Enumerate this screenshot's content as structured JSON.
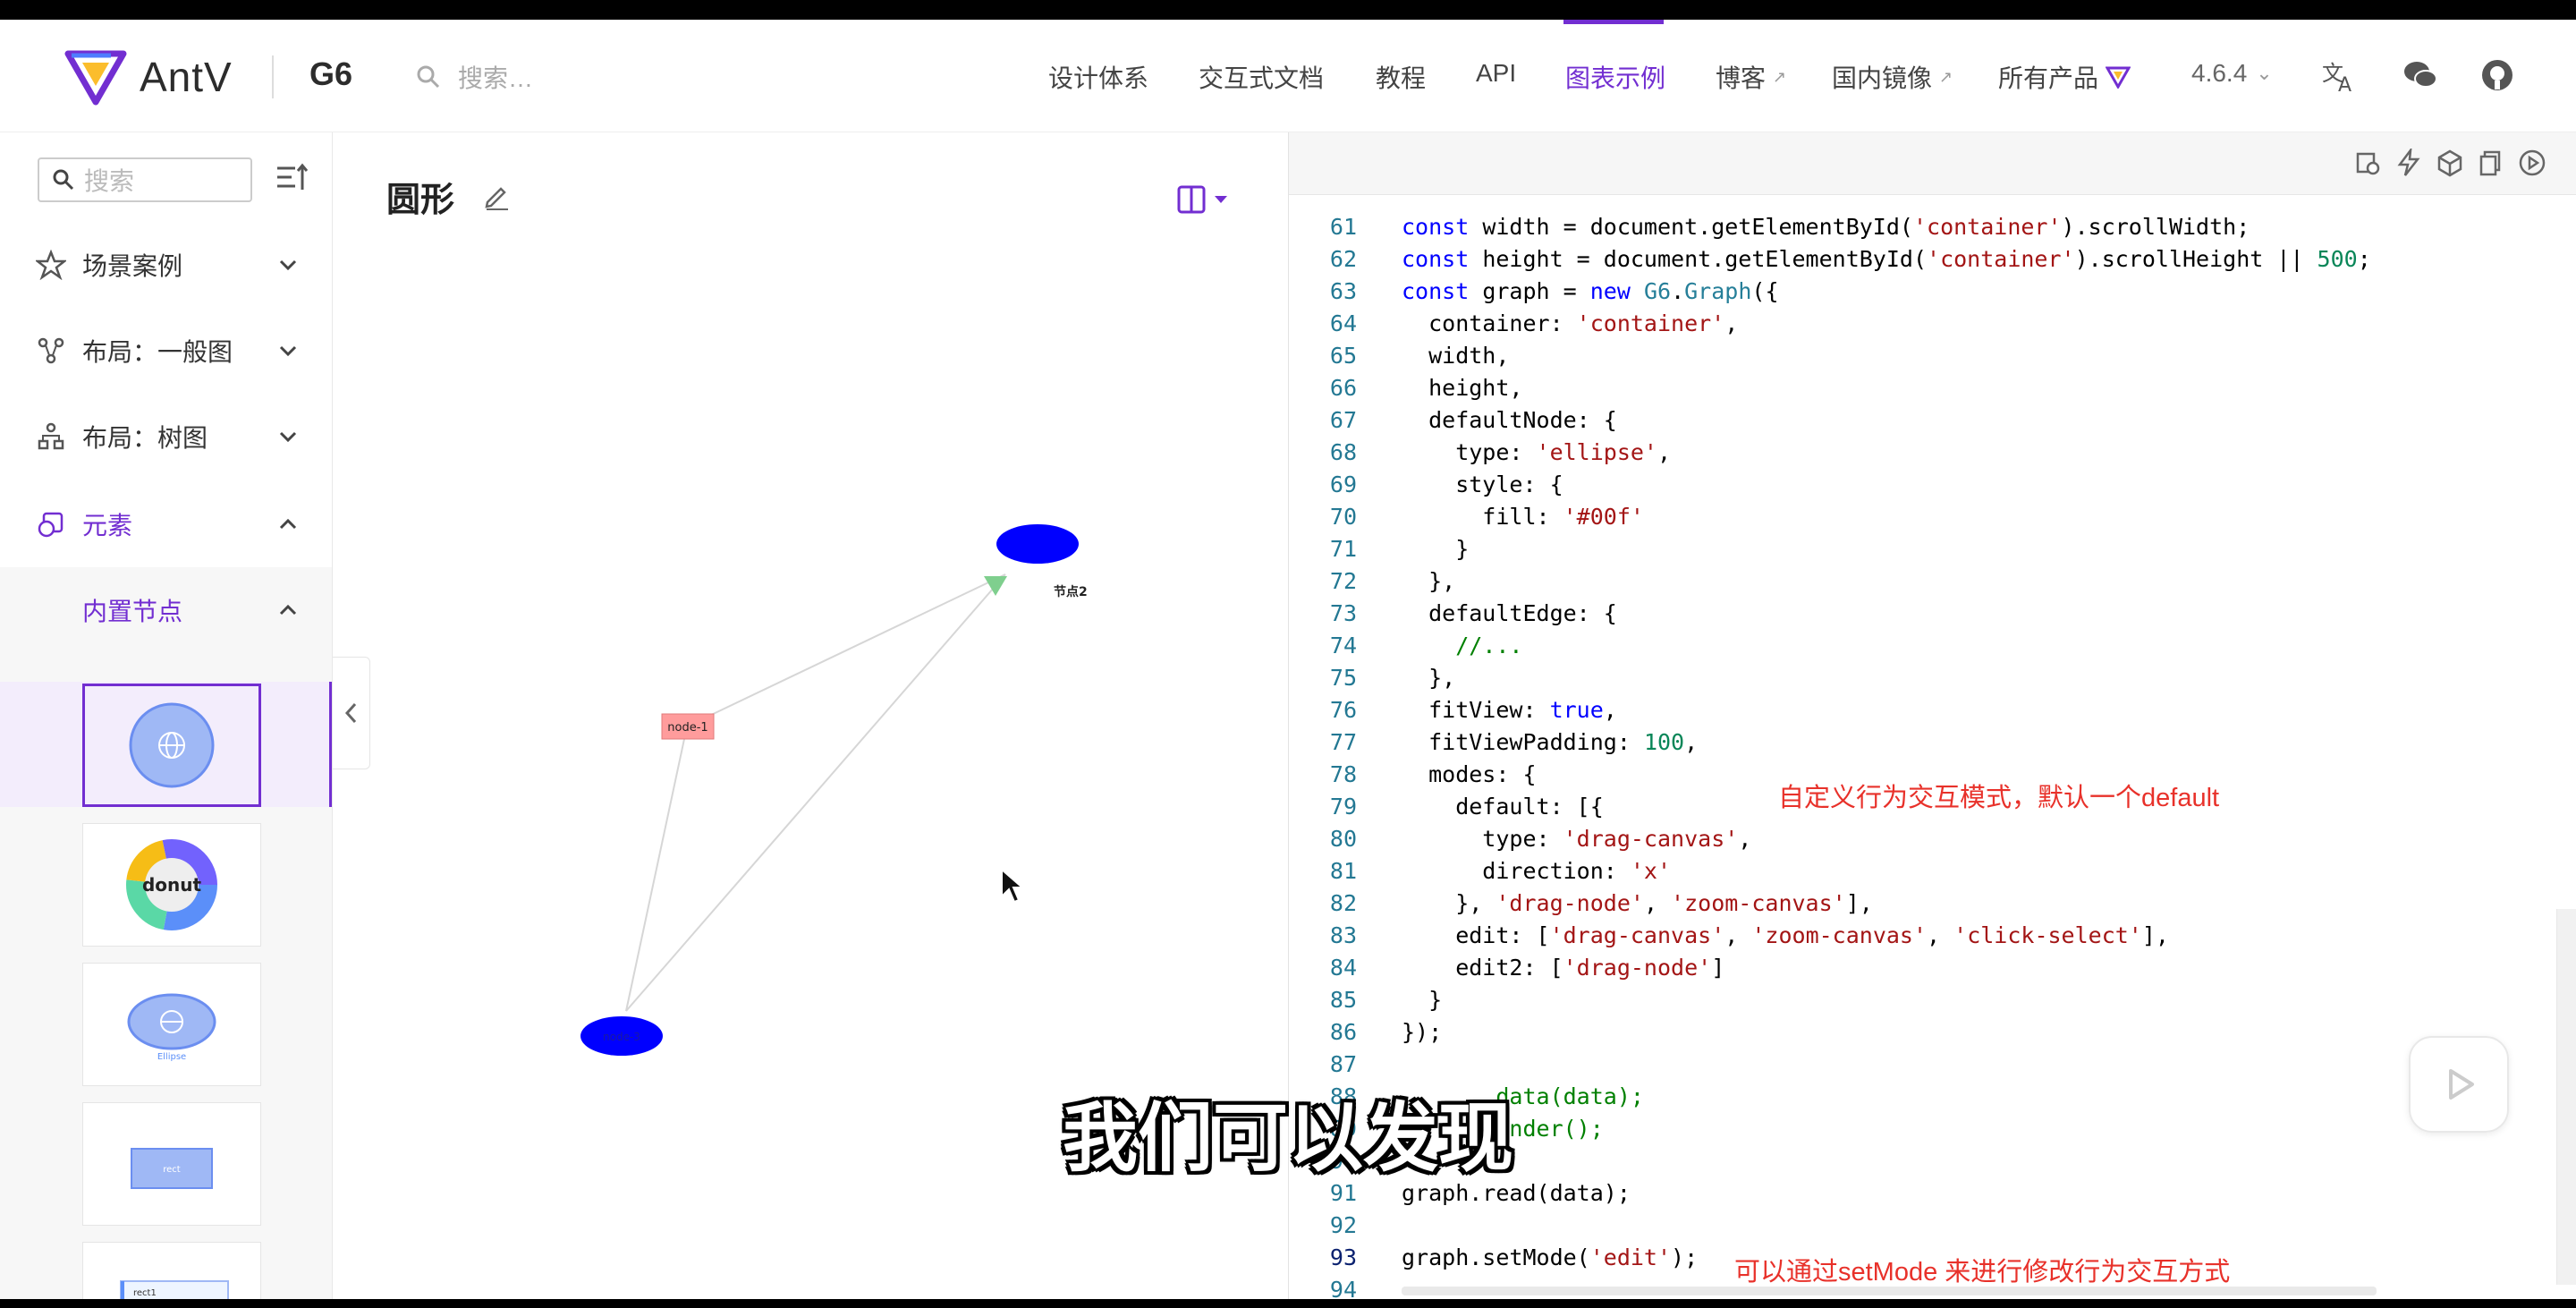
{
  "header": {
    "logo_text": "AntV",
    "product": "G6",
    "search_placeholder": "搜索…",
    "nav": [
      {
        "label": "设计体系"
      },
      {
        "label": "交互式文档"
      },
      {
        "label": "教程"
      },
      {
        "label": "API"
      },
      {
        "label": "图表示例",
        "active": true
      },
      {
        "label": "博客",
        "external": true
      },
      {
        "label": "国内镜像",
        "external": true
      },
      {
        "label": "所有产品"
      }
    ],
    "version": "4.6.4",
    "accent_color": "#722ed1"
  },
  "sidebar": {
    "search_placeholder": "搜索",
    "menu": [
      {
        "label": "场景案例",
        "icon": "star-icon"
      },
      {
        "label": "布局：一般图",
        "icon": "graph-layout-icon"
      },
      {
        "label": "布局：树图",
        "icon": "tree-layout-icon"
      },
      {
        "label": "元素",
        "icon": "element-icon",
        "open": true
      },
      {
        "label": "内置节点",
        "open": true
      }
    ],
    "thumbs": [
      {
        "name": "circle"
      },
      {
        "name": "donut",
        "label": "donut"
      },
      {
        "name": "ellipse",
        "label": "Ellipse"
      },
      {
        "name": "rect",
        "label": "rect"
      },
      {
        "name": "modelRect",
        "label": "rect1"
      }
    ]
  },
  "canvas": {
    "title": "圆形",
    "nodes": [
      {
        "id": "node-1",
        "label": "node-1",
        "shape": "rect",
        "fill": "#ff9c9c"
      },
      {
        "id": "node-2",
        "label": "节点2",
        "shape": "ellipse",
        "fill": "#0000ff"
      },
      {
        "id": "node-3",
        "label": "node-3",
        "shape": "ellipse",
        "fill": "#0000ff"
      }
    ]
  },
  "code": {
    "lines": [
      {
        "n": "61",
        "html": "<span class='kw'>const</span> width = document.getElementById(<span class='str'>'container'</span>).scrollWidth;"
      },
      {
        "n": "62",
        "html": "<span class='kw'>const</span> height = document.getElementById(<span class='str'>'container'</span>).scrollHeight || <span class='num'>500</span>;"
      },
      {
        "n": "63",
        "html": "<span class='kw'>const</span> graph = <span class='kw'>new</span> <span class='fn'>G6</span>.<span class='fn'>Graph</span>({"
      },
      {
        "n": "64",
        "html": "  container: <span class='str'>'container'</span>,"
      },
      {
        "n": "65",
        "html": "  width,"
      },
      {
        "n": "66",
        "html": "  height,"
      },
      {
        "n": "67",
        "html": "  defaultNode: {"
      },
      {
        "n": "68",
        "html": "    type: <span class='str'>'ellipse'</span>,"
      },
      {
        "n": "69",
        "html": "    style: {"
      },
      {
        "n": "70",
        "html": "      fill: <span class='str'>'#00f'</span>"
      },
      {
        "n": "71",
        "html": "    }"
      },
      {
        "n": "72",
        "html": "  },"
      },
      {
        "n": "73",
        "html": "  defaultEdge: {"
      },
      {
        "n": "74",
        "html": "    <span class='com'>//...</span>"
      },
      {
        "n": "75",
        "html": "  },"
      },
      {
        "n": "76",
        "html": "  fitView: <span class='kw'>true</span>,"
      },
      {
        "n": "77",
        "html": "  fitViewPadding: <span class='num'>100</span>,"
      },
      {
        "n": "78",
        "html": "  modes: {"
      },
      {
        "n": "79",
        "html": "    default: [{"
      },
      {
        "n": "80",
        "html": "      type: <span class='str'>'drag-canvas'</span>,"
      },
      {
        "n": "81",
        "html": "      direction: <span class='str'>'x'</span>"
      },
      {
        "n": "82",
        "html": "    }, <span class='str'>'drag-node'</span>, <span class='str'>'zoom-canvas'</span>],"
      },
      {
        "n": "83",
        "html": "    edit: [<span class='str'>'drag-canvas'</span>, <span class='str'>'zoom-canvas'</span>, <span class='str'>'click-select'</span>],"
      },
      {
        "n": "84",
        "html": "    edit2: [<span class='str'>'drag-node'</span>]"
      },
      {
        "n": "85",
        "html": "  }"
      },
      {
        "n": "86",
        "html": "});"
      },
      {
        "n": "87",
        "html": ""
      },
      {
        "n": "88",
        "html": "<span class='com'>      .data(data);</span>"
      },
      {
        "n": "89",
        "html": "<span class='com'>      render();</span>"
      },
      {
        "n": "90",
        "html": ""
      },
      {
        "n": "91",
        "html": "graph.read(data);"
      },
      {
        "n": "92",
        "html": ""
      },
      {
        "n": "93",
        "html": "graph.setMode(<span class='str'>'edit'</span>);"
      },
      {
        "n": "94",
        "html": ""
      }
    ],
    "annotation_1": "自定义行为交互模式，默认一个default",
    "annotation_2": "可以通过setMode 来进行修改行为交互方式"
  },
  "subtitle": "我们可以发现"
}
